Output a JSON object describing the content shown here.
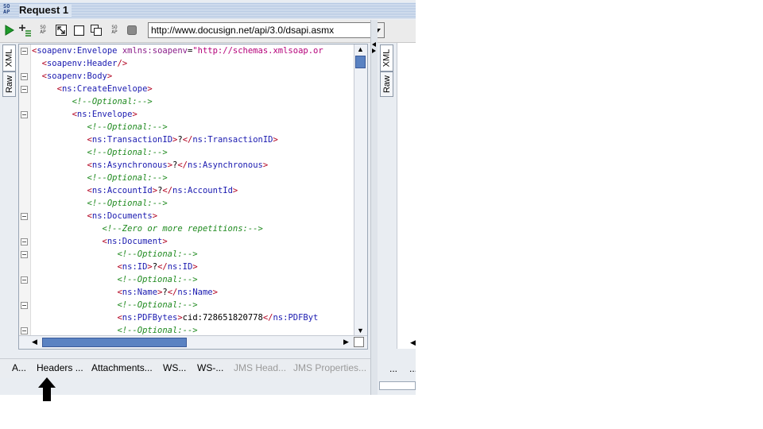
{
  "window": {
    "title": "Request 1",
    "icon": "soap-icon",
    "icon_text": "SO\nAP"
  },
  "toolbar": {
    "buttons": [
      "submit-play-icon",
      "add-assertion-icon",
      "soap-encode-icon",
      "expand-icon",
      "blank-square-icon",
      "copy-icon",
      "soap-icon",
      "stop-icon"
    ],
    "url": "http://www.docusign.net/api/3.0/dsapi.asmx"
  },
  "left_tabs": {
    "xml": "XML",
    "raw": "Raw"
  },
  "right_tabs": {
    "xml": "XML",
    "raw": "Raw"
  },
  "bottom_tabs": {
    "auth": "A...",
    "headers": "Headers ...",
    "attachments": "Attachments...",
    "ws1": "WS...",
    "ws2": "WS-...",
    "jms_headers": "JMS Head...",
    "jms_properties": "JMS Properties..."
  },
  "right_bottom_tabs": [
    "...",
    "..."
  ],
  "code_lines": [
    {
      "text": "<soapenv:Envelope xmlns:soapenv=\"http://schemas.xmlsoap.or",
      "fold": true
    },
    {
      "text": "  <soapenv:Header/>",
      "fold": false
    },
    {
      "text": "  <soapenv:Body>",
      "fold": true
    },
    {
      "text": "     <ns:CreateEnvelope>",
      "fold": true
    },
    {
      "text": "        <!--Optional:-->",
      "fold": false
    },
    {
      "text": "        <ns:Envelope>",
      "fold": true
    },
    {
      "text": "           <!--Optional:-->",
      "fold": false
    },
    {
      "text": "           <ns:TransactionID>?</ns:TransactionID>",
      "fold": false
    },
    {
      "text": "           <!--Optional:-->",
      "fold": false
    },
    {
      "text": "           <ns:Asynchronous>?</ns:Asynchronous>",
      "fold": false
    },
    {
      "text": "           <!--Optional:-->",
      "fold": false
    },
    {
      "text": "           <ns:AccountId>?</ns:AccountId>",
      "fold": false
    },
    {
      "text": "           <!--Optional:-->",
      "fold": false
    },
    {
      "text": "           <ns:Documents>",
      "fold": true
    },
    {
      "text": "              <!--Zero or more repetitions:-->",
      "fold": false
    },
    {
      "text": "              <ns:Document>",
      "fold": true
    },
    {
      "text": "                 <!--Optional:-->",
      "fold": true
    },
    {
      "text": "                 <ns:ID>?</ns:ID>",
      "fold": false
    },
    {
      "text": "                 <!--Optional:-->",
      "fold": true
    },
    {
      "text": "                 <ns:Name>?</ns:Name>",
      "fold": false
    },
    {
      "text": "                 <!--Optional:-->",
      "fold": true
    },
    {
      "text": "                 <ns:PDFBytes>cid:728651820778</ns:PDFByt",
      "fold": false
    },
    {
      "text": "                 <!--Optional:-->",
      "fold": true
    }
  ]
}
